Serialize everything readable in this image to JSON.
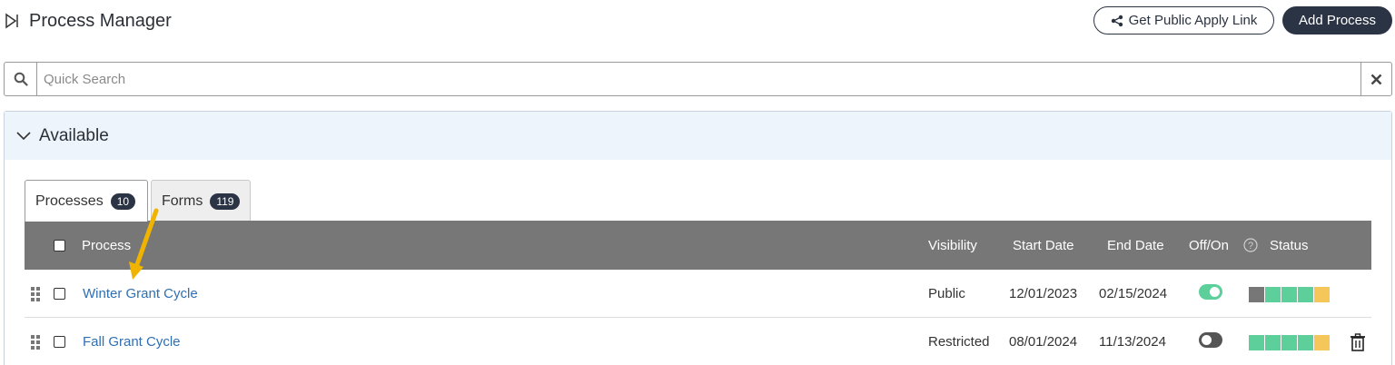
{
  "header": {
    "title": "Process Manager",
    "public_link_label": "Get Public Apply Link",
    "add_process_label": "Add Process"
  },
  "search": {
    "placeholder": "Quick Search",
    "value": ""
  },
  "panel": {
    "title": "Available"
  },
  "tabs": [
    {
      "label": "Processes",
      "count": "10",
      "active": true
    },
    {
      "label": "Forms",
      "count": "119",
      "active": false
    }
  ],
  "table": {
    "columns": {
      "process": "Process",
      "visibility": "Visibility",
      "start_date": "Start Date",
      "end_date": "End Date",
      "off_on": "Off/On",
      "status": "Status"
    },
    "rows": [
      {
        "process": "Winter Grant Cycle",
        "visibility": "Public",
        "start_date": "12/01/2023",
        "end_date": "02/15/2024",
        "enabled": true,
        "status": [
          "gray",
          "green",
          "green",
          "green",
          "yellow"
        ]
      },
      {
        "process": "Fall Grant Cycle",
        "visibility": "Restricted",
        "start_date": "08/01/2024",
        "end_date": "11/13/2024",
        "enabled": false,
        "status": [
          "green",
          "green",
          "green",
          "green",
          "yellow"
        ]
      }
    ]
  },
  "colors": {
    "toggle_on": "#5ccf9b",
    "toggle_off": "#555555",
    "status_gray": "#777777",
    "status_green": "#5ccf9b",
    "status_yellow": "#f5c75a",
    "link": "#2f6fb3",
    "header_bg": "#777777",
    "annotation_arrow": "#f0b400"
  }
}
